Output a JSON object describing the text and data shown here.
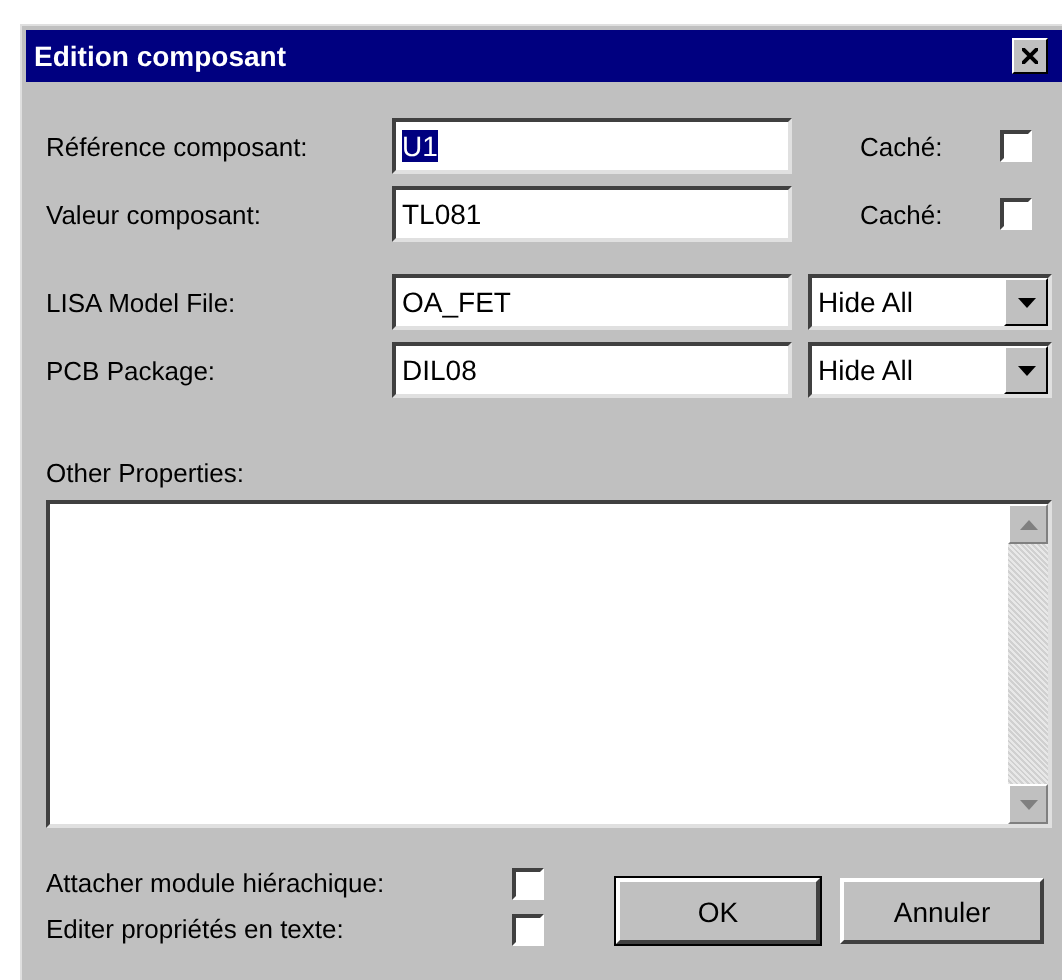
{
  "window": {
    "title": "Edition composant"
  },
  "fields": [
    {
      "label": "Référence composant:",
      "value": "U1",
      "text_selected": true,
      "hidden_label": "Caché:",
      "hidden": false
    },
    {
      "label": "Valeur composant:",
      "value": "TL081",
      "text_selected": false,
      "hidden_label": "Caché:",
      "hidden": false
    }
  ],
  "properties": [
    {
      "label": "LISA Model File:",
      "value": "OA_FET",
      "visibility": "Hide All"
    },
    {
      "label": "PCB Package:",
      "value": "DIL08",
      "visibility": "Hide All"
    }
  ],
  "other_properties": {
    "label": "Other Properties:"
  },
  "options": [
    {
      "label": "Attacher module hiérachique:",
      "checked": false
    },
    {
      "label": "Editer propriétés en texte:",
      "checked": false
    }
  ],
  "buttons": [
    {
      "label": "OK",
      "default": true
    },
    {
      "label": "Annuler",
      "default": false
    }
  ]
}
